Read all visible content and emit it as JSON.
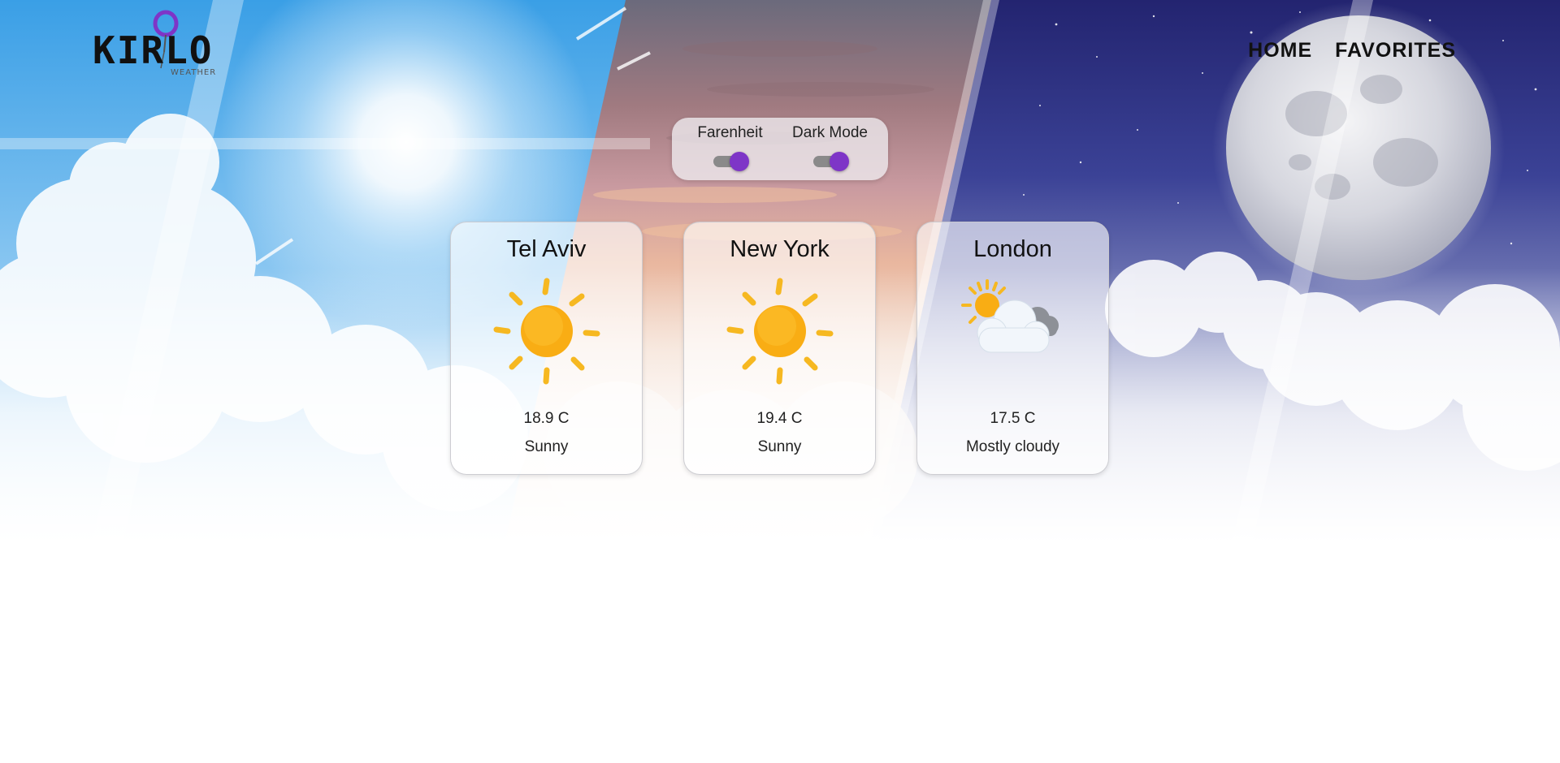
{
  "app": {
    "logo": {
      "main_text": "KIRLO",
      "sub_text": "WEATHER"
    }
  },
  "nav": {
    "home_label": "HOME",
    "favorites_label": "FAVORITES"
  },
  "settings": {
    "farenheit_label": "Farenheit",
    "dark_mode_label": "Dark Mode",
    "toggle_accent": "#7e35c7"
  },
  "cities": [
    {
      "name": "Tel Aviv",
      "temperature": "18.9 C",
      "condition": "Sunny",
      "icon": "sun-icon"
    },
    {
      "name": "New York",
      "temperature": "19.4 C",
      "condition": "Sunny",
      "icon": "sun-icon"
    },
    {
      "name": "London",
      "temperature": "17.5 C",
      "condition": "Mostly cloudy",
      "icon": "partly-cloudy-icon"
    }
  ]
}
